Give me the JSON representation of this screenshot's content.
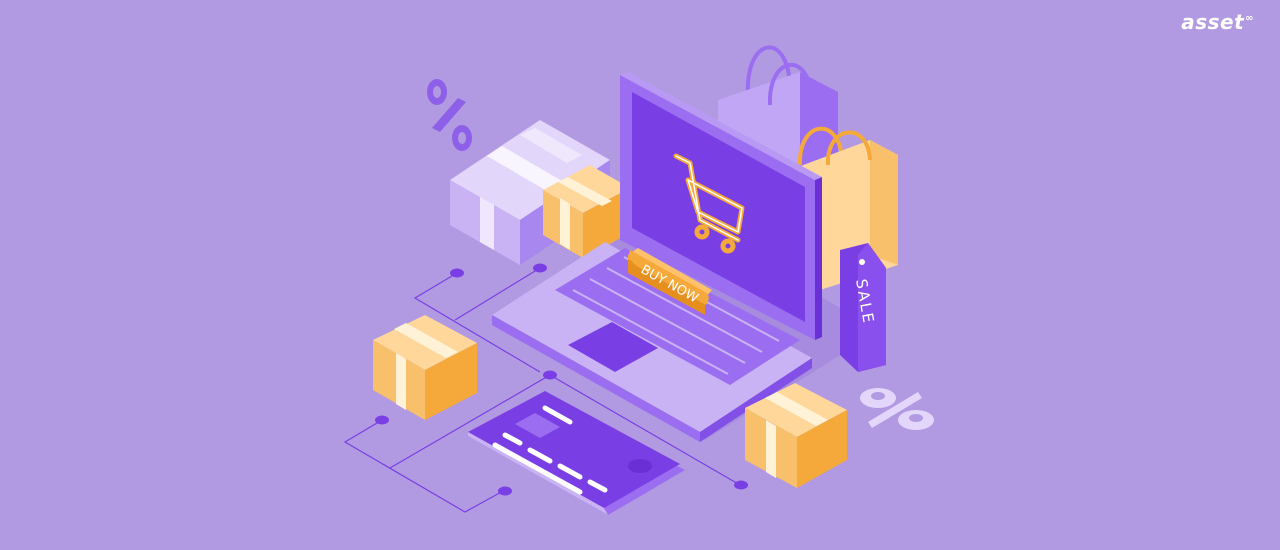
{
  "brand": {
    "logo_text": "asset",
    "logo_mark": "∞"
  },
  "laptop": {
    "screen_icon": "shopping-cart-icon",
    "button_label": "BUY NOW"
  },
  "tag": {
    "label": "SALE"
  },
  "symbols": {
    "percent": "%"
  },
  "colors": {
    "background": "#b19ae2",
    "purple_dark": "#7a3fe4",
    "purple_mid": "#9b6df0",
    "lilac": "#c9b3f5",
    "orange": "#f5a93a",
    "cream": "#ffe8c0"
  }
}
